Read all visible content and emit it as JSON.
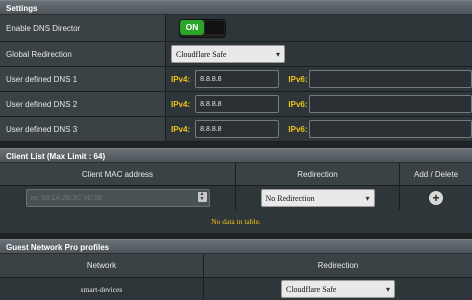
{
  "settings": {
    "header": "Settings",
    "enable_dns_director": {
      "label": "Enable DNS Director",
      "toggle_text": "ON"
    },
    "global_redirection": {
      "label": "Global Redirection",
      "value": "Cloudflare Safe"
    },
    "dns": [
      {
        "label": "User defined DNS 1",
        "ipv4_label": "IPv4:",
        "ipv4": "8.8.8.8",
        "ipv6_label": "IPv6:",
        "ipv6": ""
      },
      {
        "label": "User defined DNS 2",
        "ipv4_label": "IPv4:",
        "ipv4": "8.8.8.8",
        "ipv6_label": "IPv6:",
        "ipv6": ""
      },
      {
        "label": "User defined DNS 3",
        "ipv4_label": "IPv4:",
        "ipv4": "8.8.8.8",
        "ipv6_label": "IPv6:",
        "ipv6": ""
      }
    ]
  },
  "client_list": {
    "header": "Client List (Max Limit : 64)",
    "columns": [
      "Client MAC address",
      "Redirection",
      "Add / Delete"
    ],
    "mac_placeholder": "ex: 00:1A:2B:3C:4D:5E",
    "redirection_value": "No Redirection",
    "empty_text": "No data in table."
  },
  "guest_network": {
    "header": "Guest Network Pro profiles",
    "columns": [
      "Network",
      "Redirection"
    ],
    "rows": [
      {
        "network": "smart-devices",
        "redirection": "Cloudflare Safe"
      }
    ]
  },
  "colors": {
    "accent": "#f2c318",
    "toggle_on": "#2aa52a",
    "background": "#1f2326"
  }
}
